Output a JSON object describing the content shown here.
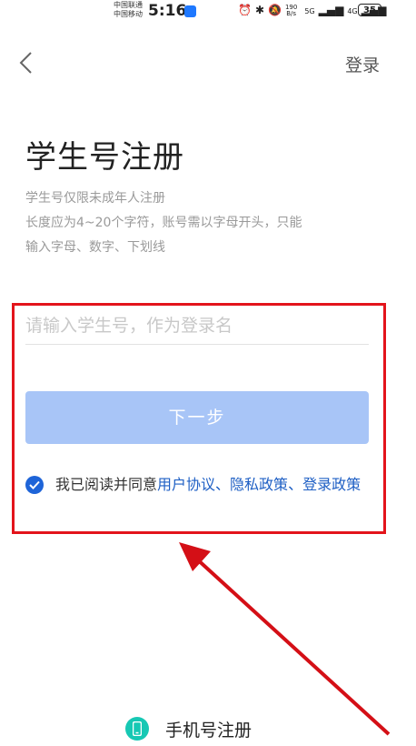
{
  "status_bar": {
    "carrier_1": "中国联通",
    "carrier_2": "中国移动",
    "time": "5:16",
    "net_speed_value": "190",
    "net_speed_unit": "B/s",
    "signal_1": "5G",
    "signal_2": "4G",
    "battery": "35"
  },
  "nav": {
    "back_icon": "chevron-left-icon",
    "login_label": "登录"
  },
  "page": {
    "title": "学生号注册",
    "hint_line_1": "学生号仅限未成年人注册",
    "hint_line_2": "长度应为4~20个字符，账号需以字母开头，只能",
    "hint_line_3": "输入字母、数字、下划线"
  },
  "form": {
    "input_placeholder": "请输入学生号，作为登录名",
    "input_value": "",
    "next_button": "下一步",
    "agreement_checked": true,
    "agreement_prefix": "我已阅读并同意",
    "link_user_agreement": "用户协议",
    "separator_1": "、",
    "link_privacy": "隐私政策",
    "separator_2": "、",
    "link_login_policy": "登录政策"
  },
  "footer": {
    "phone_register_label": "手机号注册",
    "phone_icon": "phone-icon"
  },
  "colors": {
    "primary": "#1e64d8",
    "button_disabled": "#a8c5f7",
    "annotation_red": "#e3141b",
    "phone_icon_teal": "#17c8b4"
  }
}
